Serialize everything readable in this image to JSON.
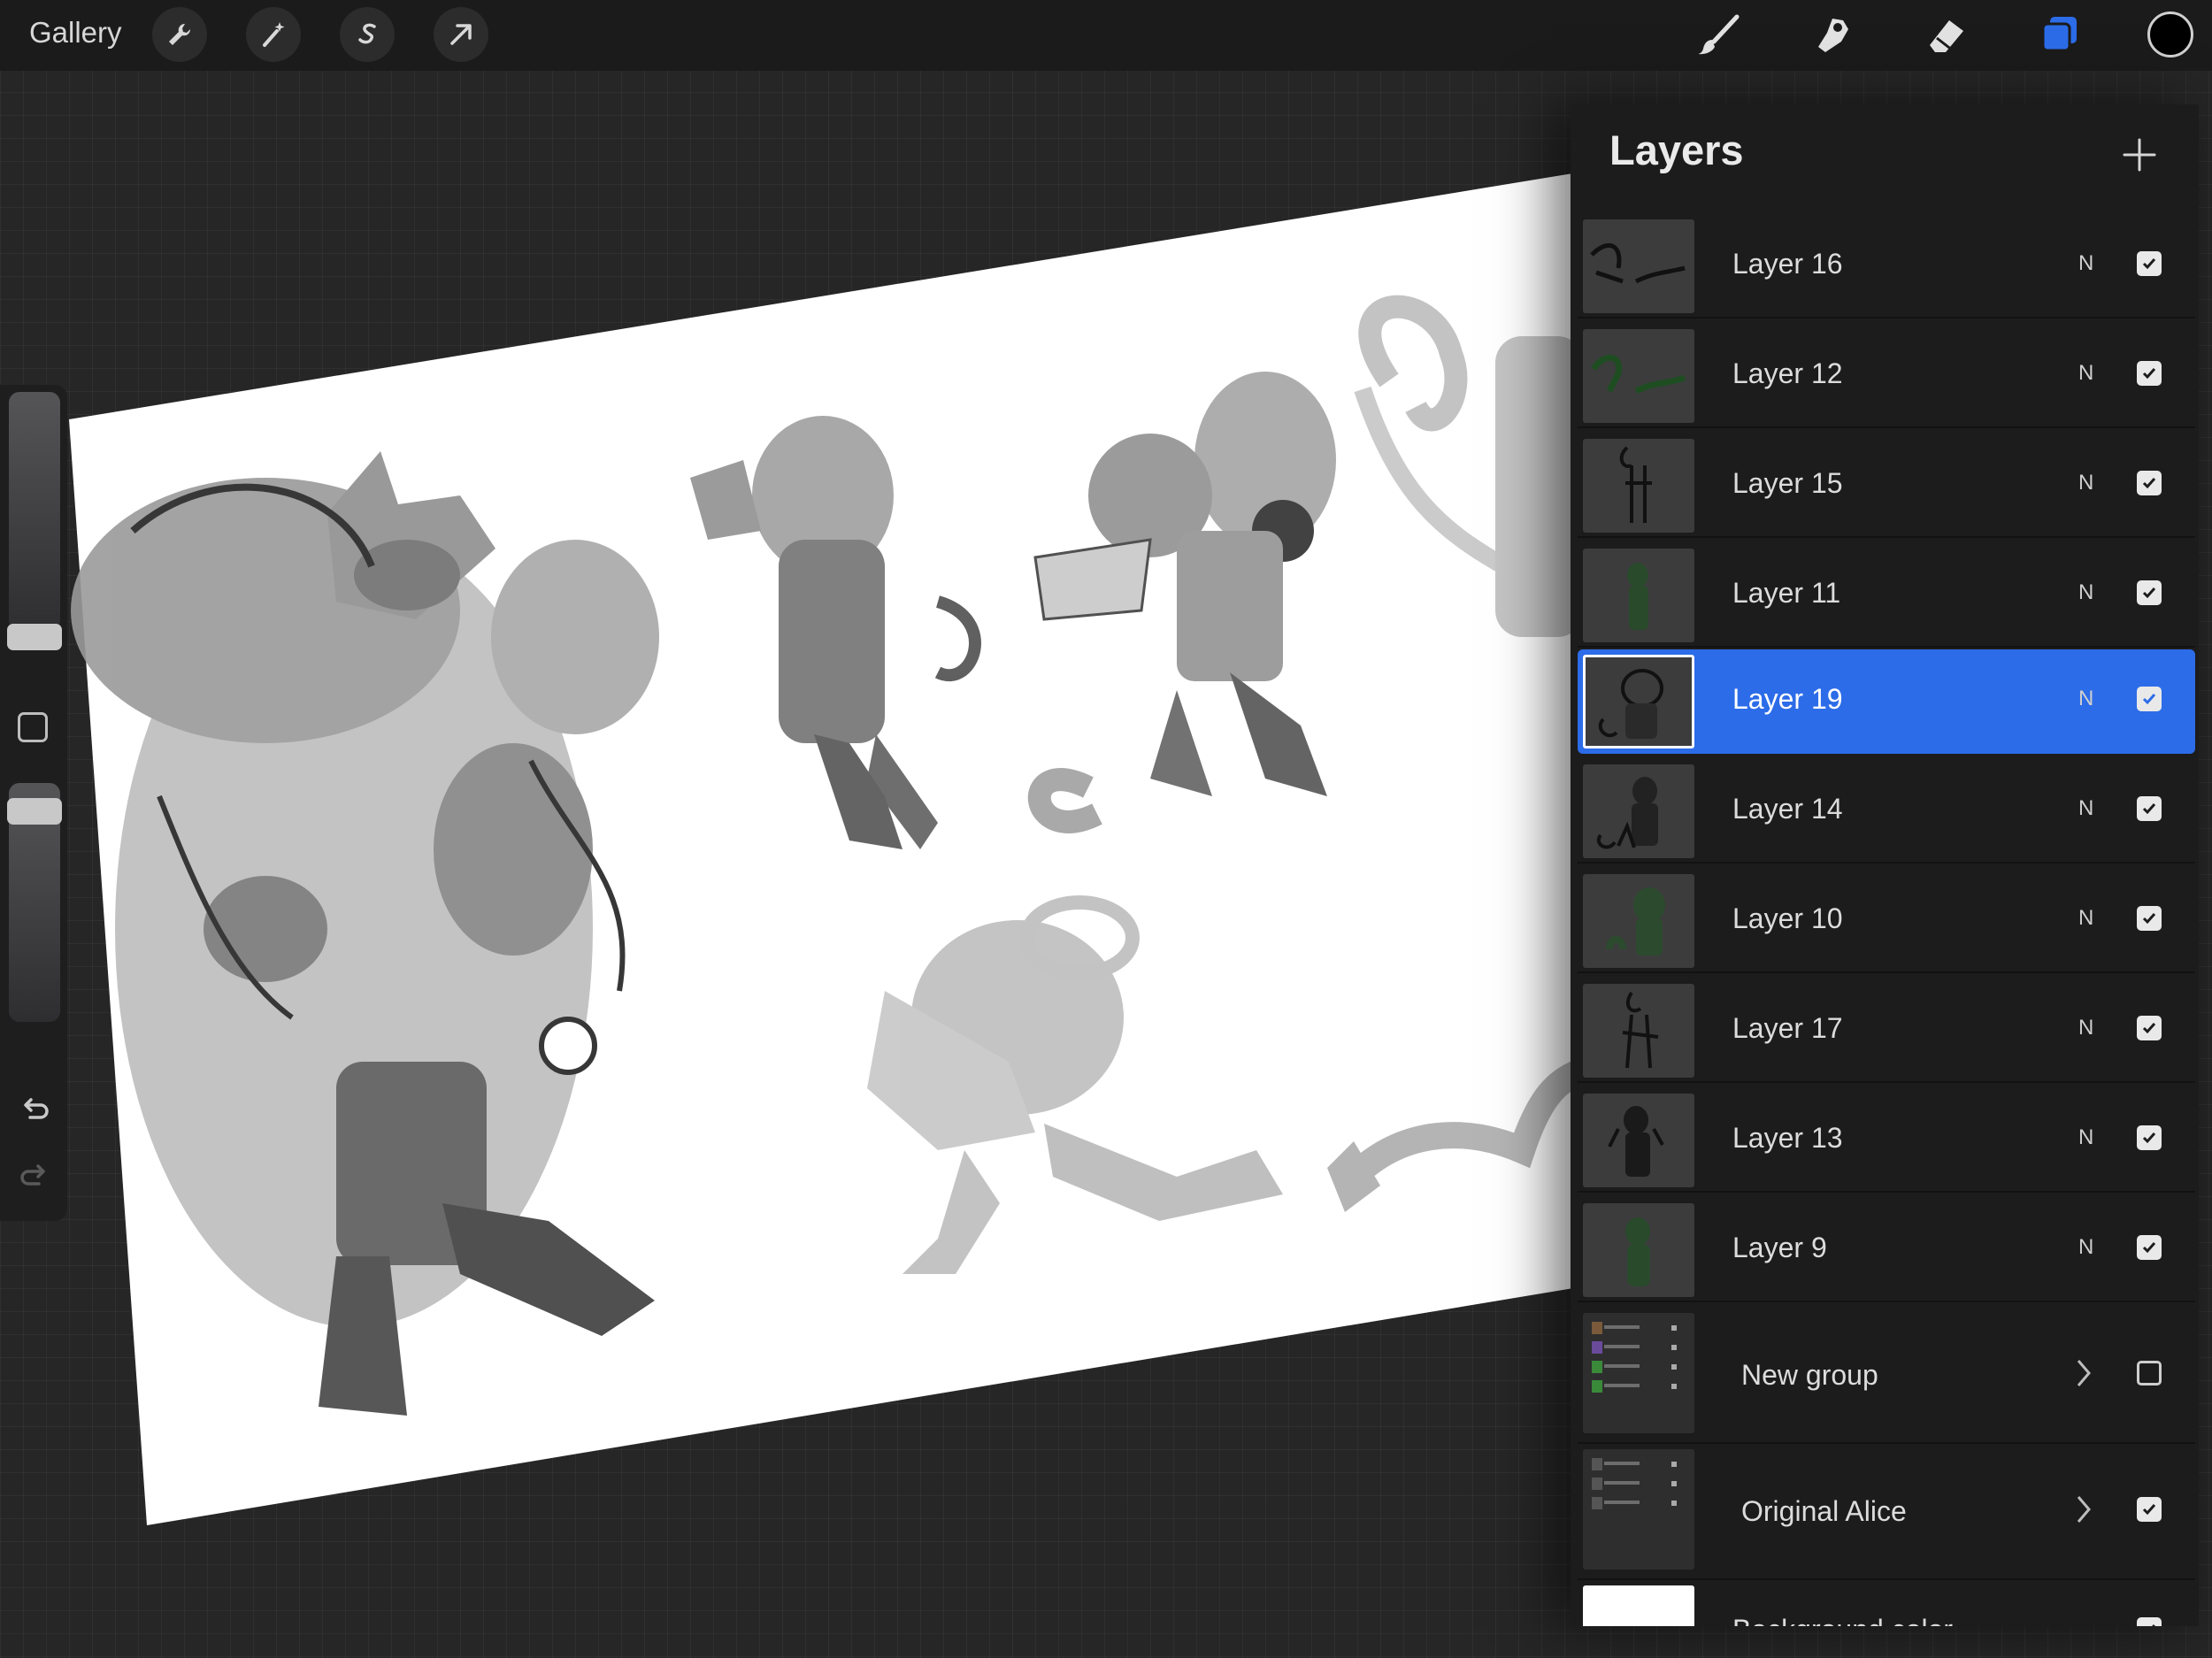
{
  "app": {
    "gallery_label": "Gallery",
    "tools_left": [
      {
        "icon": "wrench-icon"
      },
      {
        "icon": "magic-wand-icon"
      },
      {
        "icon": "selection-icon"
      },
      {
        "icon": "transform-arrow-icon"
      }
    ],
    "tools_right": [
      {
        "icon": "brush-icon"
      },
      {
        "icon": "smudge-icon"
      },
      {
        "icon": "eraser-icon"
      },
      {
        "icon": "layers-icon"
      }
    ],
    "current_color": "#000000",
    "accent_color": "#2c6ce8"
  },
  "sidebar": {
    "size_slider_level": 0.55,
    "opacity_slider_level": 0.05,
    "modify_icon": "square-icon",
    "undo_icon": "undo-icon",
    "redo_icon": "redo-icon"
  },
  "layers": {
    "title": "Layers",
    "add_icon": "plus-icon",
    "items": [
      {
        "name": "Layer 16",
        "blend": "N",
        "visible": true,
        "selected": false
      },
      {
        "name": "Layer 12",
        "blend": "N",
        "visible": true,
        "selected": false
      },
      {
        "name": "Layer 15",
        "blend": "N",
        "visible": true,
        "selected": false
      },
      {
        "name": "Layer 11",
        "blend": "N",
        "visible": true,
        "selected": false
      },
      {
        "name": "Layer 19",
        "blend": "N",
        "visible": true,
        "selected": true
      },
      {
        "name": "Layer 14",
        "blend": "N",
        "visible": true,
        "selected": false
      },
      {
        "name": "Layer 10",
        "blend": "N",
        "visible": true,
        "selected": false
      },
      {
        "name": "Layer 17",
        "blend": "N",
        "visible": true,
        "selected": false
      },
      {
        "name": "Layer 13",
        "blend": "N",
        "visible": true,
        "selected": false
      },
      {
        "name": "Layer 9",
        "blend": "N",
        "visible": true,
        "selected": false
      }
    ],
    "groups": [
      {
        "name": "New group",
        "visible": false
      },
      {
        "name": "Original Alice",
        "visible": true
      }
    ],
    "background": {
      "name": "Background color",
      "visible": true
    }
  }
}
